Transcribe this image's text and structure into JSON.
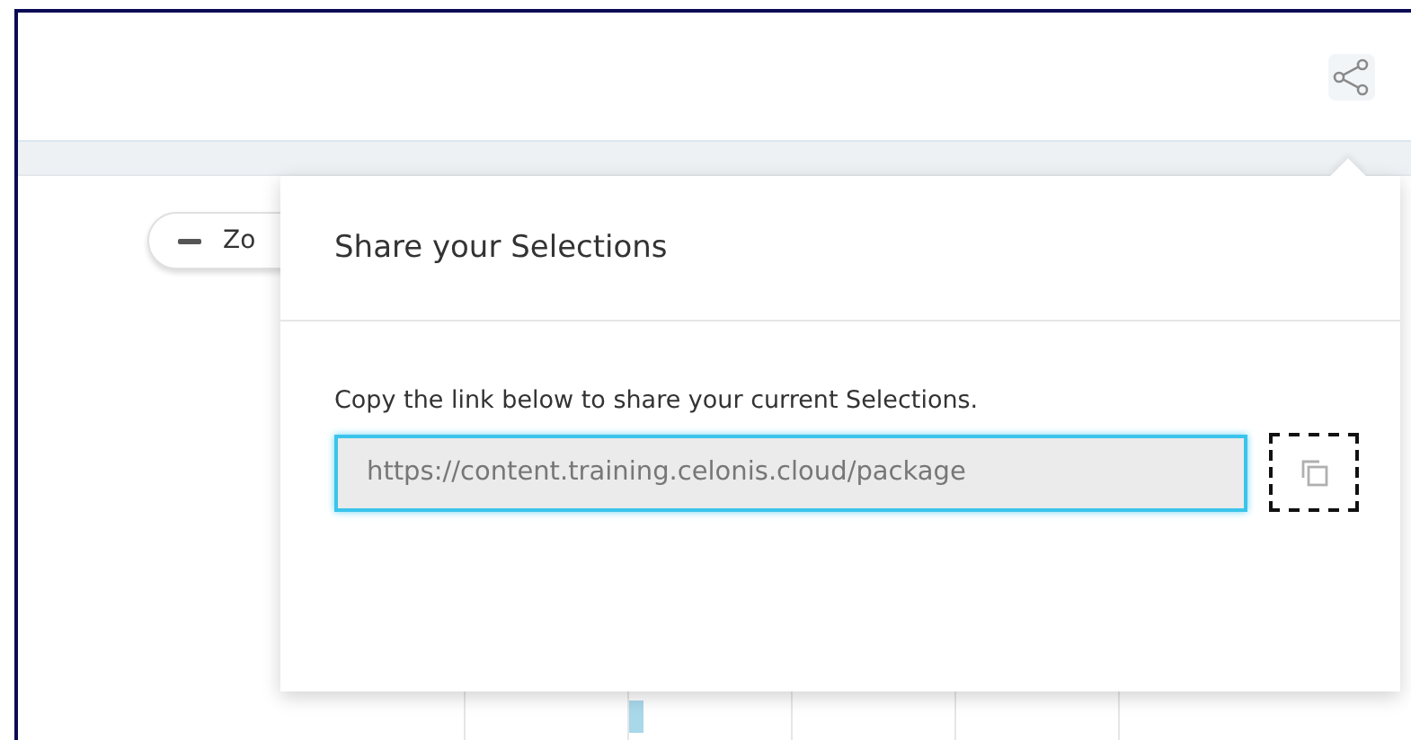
{
  "toolbar": {
    "share_button": {
      "expanded": true
    }
  },
  "zoom_control": {
    "label": "Zo"
  },
  "share_popover": {
    "title": "Share your Selections",
    "description": "Copy the link below to share your current Selections.",
    "link_field": {
      "value": "https://content.training.celonis.cloud/package",
      "focused": true
    },
    "copy_button": {
      "focused": true
    }
  }
}
